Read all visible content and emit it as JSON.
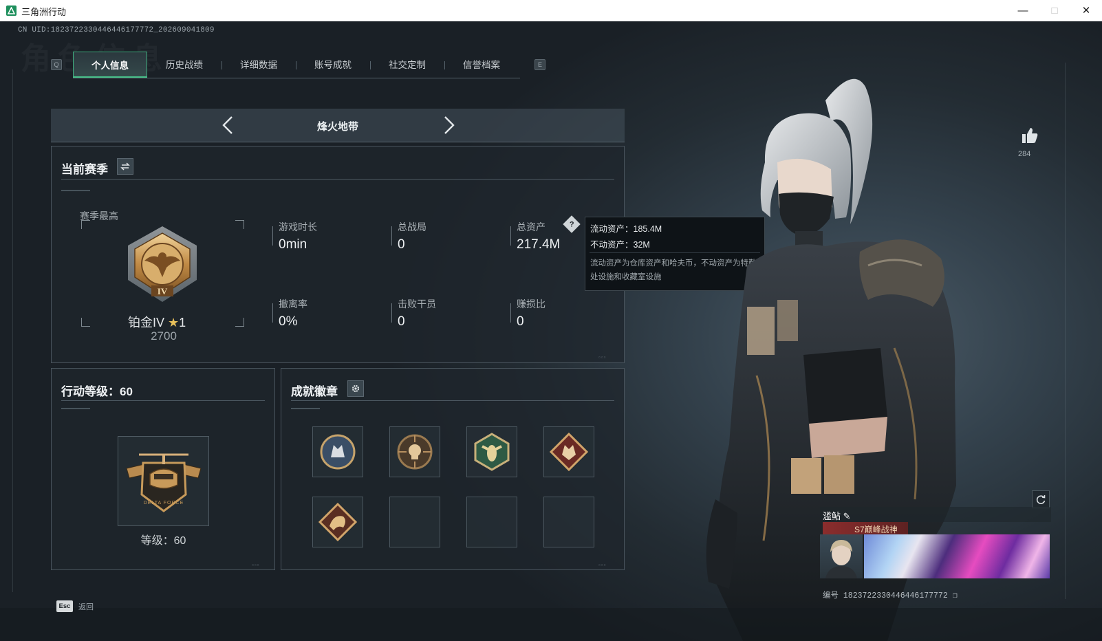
{
  "window": {
    "title": "三角洲行动"
  },
  "header": {
    "uid": "CN UID:1823722330446446177772_202609041809",
    "ghost_title": "角色信息",
    "tab_prev_key": "Q",
    "tab_next_key": "E",
    "tabs": [
      {
        "label": "个人信息",
        "active": true
      },
      {
        "label": "历史战绩"
      },
      {
        "label": "详细数据"
      },
      {
        "label": "账号成就"
      },
      {
        "label": "社交定制"
      },
      {
        "label": "信誉档案"
      }
    ]
  },
  "map_selector": {
    "name": "烽火地带"
  },
  "season": {
    "title": "当前赛季",
    "best_label": "赛季最高",
    "rank_name": "铂金IV",
    "rank_stars": "1",
    "rank_score": "2700",
    "stats": [
      {
        "label": "游戏时长",
        "value": "0min"
      },
      {
        "label": "总战局",
        "value": "0"
      },
      {
        "label": "总资产",
        "value": "217.4M"
      },
      {
        "label": "撤离率",
        "value": "0%"
      },
      {
        "label": "击败干员",
        "value": "0"
      },
      {
        "label": "赚损比",
        "value": "0"
      }
    ]
  },
  "tooltip": {
    "liquid": "流动资产：185.4M",
    "fixed": "不动资产：32M",
    "description": "流动资产为仓库资产和哈夫币，不动资产为特勤处设施和收藏室设施"
  },
  "level": {
    "title": "行动等级：60",
    "label": "等级：60"
  },
  "badges": {
    "title": "成就徽章",
    "slots": 8,
    "filled": 5
  },
  "likes": {
    "count": "284"
  },
  "card": {
    "name": "滥鲇",
    "title": "S7巅峰战神",
    "id": "编号 1823722330446446177772"
  },
  "footer": {
    "esc_key": "Esc",
    "esc_label": "返回"
  },
  "colors": {
    "accent": "#47c089",
    "background": "#1b2228",
    "panel_border": "#4a555e",
    "gold": "#c99a56"
  }
}
